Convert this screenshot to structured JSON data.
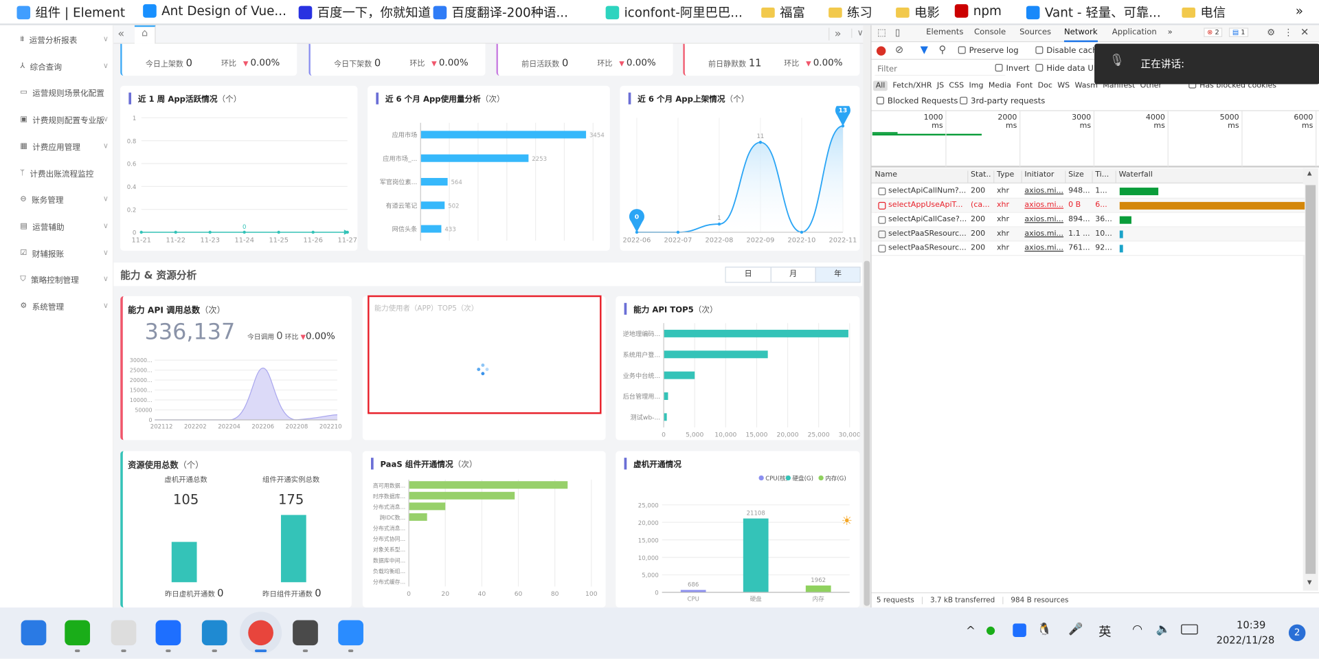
{
  "bookmarks": [
    {
      "label": "组件 | Element",
      "icon": "element-shield-icon",
      "color": "#409eff"
    },
    {
      "label": "Ant Design of Vue...",
      "icon": "antd-icon",
      "color": "#1890ff"
    },
    {
      "label": "百度一下，你就知道",
      "icon": "baidu-paw-icon",
      "color": "#2932e1"
    },
    {
      "label": "百度翻译-200种语...",
      "icon": "baidu-translate-icon",
      "color": "#2f7cf6"
    },
    {
      "label": "iconfont-阿里巴巴...",
      "icon": "iconfont-icon",
      "color": "#2dd4bf"
    },
    {
      "label": "福富",
      "icon": "folder-icon"
    },
    {
      "label": "练习",
      "icon": "folder-icon"
    },
    {
      "label": "电影",
      "icon": "folder-icon"
    },
    {
      "label": "npm",
      "icon": "npm-icon",
      "color": "#cb0000"
    },
    {
      "label": "Vant - 轻量、可靠...",
      "icon": "vant-icon",
      "color": "#1989fa"
    },
    {
      "label": "电信",
      "icon": "folder-icon"
    }
  ],
  "bookmarks_more": "»",
  "sidebar": {
    "items": [
      {
        "label": "运营分析报表",
        "icon": "sitemap-icon",
        "chevron": true
      },
      {
        "label": "综合查询",
        "icon": "share-nodes-icon",
        "chevron": true
      },
      {
        "label": "运营规则场景化配置",
        "icon": "folder-icon",
        "chevron": false
      },
      {
        "label": "计费规则配置专业版",
        "icon": "grid-icon",
        "chevron": true
      },
      {
        "label": "计费应用管理",
        "icon": "app-icon",
        "chevron": true
      },
      {
        "label": "计费出账流程监控",
        "icon": "branch-icon",
        "chevron": false
      },
      {
        "label": "账务管理",
        "icon": "wallet-icon",
        "chevron": true
      },
      {
        "label": "运营辅助",
        "icon": "clipboard-icon",
        "chevron": true
      },
      {
        "label": "财辅报账",
        "icon": "edit-icon",
        "chevron": true
      },
      {
        "label": "策略控制管理",
        "icon": "shield-icon",
        "chevron": true
      },
      {
        "label": "系统管理",
        "icon": "gear-icon",
        "chevron": true
      }
    ]
  },
  "tabs": {
    "collapse": "«",
    "home": "⌂",
    "more": "»",
    "dropdown": "∨"
  },
  "stats": [
    {
      "label": "今日上架数",
      "value": "0",
      "ratio_label": "环比",
      "ratio": "0.00%",
      "color": "#3aa8f5"
    },
    {
      "label": "今日下架数",
      "value": "0",
      "ratio_label": "环比",
      "ratio": "0.00%",
      "color": "#8b8ff0"
    },
    {
      "label": "前日活跃数",
      "value": "0",
      "ratio_label": "环比",
      "ratio": "0.00%",
      "color": "#c77de0"
    },
    {
      "label": "前日静默数",
      "value": "11",
      "ratio_label": "环比",
      "ratio": "0.00%",
      "color": "#f0566b"
    }
  ],
  "section": {
    "title": "能力 & 资源分析",
    "periods": [
      "日",
      "月",
      "年"
    ],
    "active_period": "年"
  },
  "cards": {
    "weekly": {
      "title": "近 1 周 App活跃情况",
      "unit": "（个）"
    },
    "usage": {
      "title": "近 6 个月 App使用量分析",
      "unit": "（次）"
    },
    "listing": {
      "title": "近 6 个月 App上架情况",
      "unit": "（个）"
    },
    "api_total": {
      "title": "能力 API 调用总数",
      "unit": "（次）",
      "total": "336,137",
      "today_label": "今日调用",
      "today": "0",
      "ratio_label": "环比",
      "ratio": "0.00%"
    },
    "app_top5": {
      "title": "能力使用者（APP）TOP5（次）",
      "state": "loading"
    },
    "api_top5": {
      "title": "能力 API TOP5",
      "unit": "（次）"
    },
    "resource": {
      "title": "资源使用总数",
      "unit": "（个）",
      "vm_label": "虚机开通总数",
      "vm_total": "105",
      "comp_label": "组件开通实例总数",
      "comp_total": "175",
      "vm_yday_label": "昨日虚机开通数",
      "vm_yday": "0",
      "comp_yday_label": "昨日组件开通数",
      "comp_yday": "0"
    },
    "paas": {
      "title": "PaaS 组件开通情况",
      "unit": "（次）"
    },
    "vm": {
      "title": "虚机开通情况"
    }
  },
  "chart_data": [
    {
      "id": "weekly",
      "type": "line",
      "categories": [
        "11-21",
        "11-22",
        "11-23",
        "11-24",
        "11-25",
        "11-26",
        "11-27"
      ],
      "values": [
        0,
        0,
        0,
        0,
        0,
        0,
        0
      ],
      "data_labels": {
        "11-24": "0"
      },
      "ylim": [
        0,
        1
      ],
      "yticks": [
        "0",
        "0.2",
        "0.4",
        "0.6",
        "0.8",
        "1"
      ],
      "color": "#34c3b8",
      "grid": true
    },
    {
      "id": "usage",
      "type": "bar",
      "orientation": "horizontal",
      "categories": [
        "应用市场",
        "应用市场_...",
        "军官岗位素...",
        "有道云笔记",
        "网信头条"
      ],
      "values": [
        3454,
        2253,
        564,
        502,
        433
      ],
      "xlim": [
        0,
        3600
      ],
      "color": "#36b8fb",
      "grid": true
    },
    {
      "id": "listing",
      "type": "area",
      "categories": [
        "2022-06",
        "2022-07",
        "2022-08",
        "2022-09",
        "2022-10",
        "2022-11"
      ],
      "values": [
        0,
        0,
        1,
        11,
        0,
        13
      ],
      "ylim": [
        0,
        14
      ],
      "pins": [
        "0",
        "13"
      ],
      "color": "#2aa5f5"
    },
    {
      "id": "api_total",
      "type": "area",
      "categories": [
        "202112",
        "202202",
        "202204",
        "202206",
        "202208",
        "202210"
      ],
      "yticks": [
        "0",
        "50000",
        "10000...",
        "15000...",
        "20000...",
        "25000...",
        "30000..."
      ],
      "ylim": [
        0,
        30000
      ],
      "peak_category": "202206",
      "peak_value": 26000,
      "color": "#a9a6ee"
    },
    {
      "id": "api_top5",
      "type": "bar",
      "orientation": "horizontal",
      "categories": [
        "逆地理编码...",
        "系统用户登...",
        "业务中台统...",
        "后台管理用...",
        "测试wb-..."
      ],
      "values": [
        29800,
        16800,
        5000,
        700,
        500
      ],
      "xlim": [
        0,
        30000
      ],
      "xticks": [
        "0",
        "5,000",
        "10,000",
        "15,000",
        "20,000",
        "25,000",
        "30,000"
      ],
      "color": "#34c3b8",
      "grid": true
    },
    {
      "id": "resource",
      "type": "bar",
      "categories": [
        "虚机开通总数",
        "组件开通实例总数"
      ],
      "values": [
        105,
        175
      ],
      "color": "#34c3b8"
    },
    {
      "id": "paas",
      "type": "bar",
      "orientation": "horizontal",
      "categories": [
        "高可用数据...",
        "时序数据库...",
        "分布式消息...",
        "跨IDC数...",
        "分布式消息...",
        "分布式协同...",
        "对象关系型...",
        "数据库中间...",
        "负载均衡组...",
        "分布式缓存..."
      ],
      "values": [
        87,
        58,
        20,
        10,
        0,
        0,
        0,
        0,
        0,
        0
      ],
      "xlim": [
        0,
        100
      ],
      "xticks": [
        "0",
        "20",
        "40",
        "60",
        "80",
        "100"
      ],
      "color": "#97d06a",
      "grid": true
    },
    {
      "id": "vm",
      "type": "bar",
      "categories": [
        "CPU",
        "硬盘",
        "内存"
      ],
      "values": [
        686,
        21108,
        1962
      ],
      "ylim": [
        0,
        25000
      ],
      "yticks": [
        "0",
        "5,000",
        "10,000",
        "15,000",
        "20,000",
        "25,000"
      ],
      "legend": [
        "CPU(核)",
        "硬盘(G)",
        "内存(G)"
      ],
      "legend_position": "top-right",
      "colors": [
        "#8b8ff0",
        "#34c3b8",
        "#8fd15e"
      ],
      "grid": true
    }
  ],
  "devtools": {
    "tabs": [
      "Elements",
      "Console",
      "Sources",
      "Network",
      "Application"
    ],
    "active_tab": "Network",
    "more": "»",
    "errors": "2",
    "messages": "1",
    "preserve_log": "Preserve log",
    "disable_cache": "Disable cach",
    "filter_placeholder": "Filter",
    "invert": "Invert",
    "hide_data": "Hide data UR",
    "types": [
      "All",
      "Fetch/XHR",
      "JS",
      "CSS",
      "Img",
      "Media",
      "Font",
      "Doc",
      "WS",
      "Wasm",
      "Manifest",
      "Other"
    ],
    "has_blocked": "Has blocked cookies",
    "blocked": "Blocked Requests",
    "third_party": "3rd-party requests",
    "timeline": [
      "1000 ms",
      "2000 ms",
      "3000 ms",
      "4000 ms",
      "5000 ms",
      "6000 ms"
    ],
    "columns": [
      "Name",
      "Stat..",
      "Type",
      "Initiator",
      "Size",
      "Ti...",
      "Waterfall"
    ],
    "rows": [
      {
        "name": "selectApiCallNum?...",
        "status": "200",
        "type": "xhr",
        "initiator": "axios.mi...",
        "size": "948...",
        "time": "1...",
        "error": false
      },
      {
        "name": "selectAppUseApiT...",
        "status": "(ca...",
        "type": "xhr",
        "initiator": "axios.mi...",
        "size": "0 B",
        "time": "6...",
        "error": true
      },
      {
        "name": "selectApiCallCase?...",
        "status": "200",
        "type": "xhr",
        "initiator": "axios.mi...",
        "size": "894...",
        "time": "36...",
        "error": false
      },
      {
        "name": "selectPaaSResourc...",
        "status": "200",
        "type": "xhr",
        "initiator": "axios.mi...",
        "size": "1.1 ...",
        "time": "10...",
        "error": false
      },
      {
        "name": "selectPaaSResourc...",
        "status": "200",
        "type": "xhr",
        "initiator": "axios.mi...",
        "size": "761...",
        "time": "92...",
        "error": false
      }
    ],
    "summary": [
      "5 requests",
      "3.7 kB transferred",
      "984 B resources"
    ],
    "speaking": "正在讲话:"
  },
  "taskbar": {
    "time": "10:39",
    "date": "2022/11/28",
    "ime": "英",
    "notifications": "2"
  }
}
